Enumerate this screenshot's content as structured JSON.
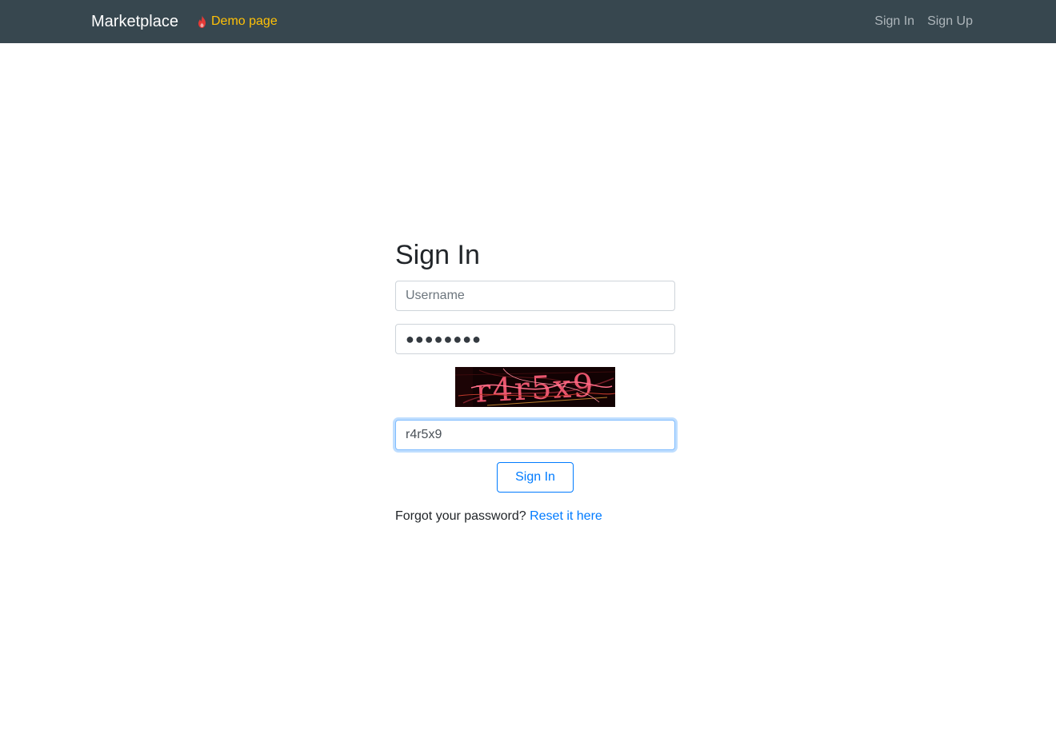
{
  "navbar": {
    "brand": "Marketplace",
    "demo_label": "Demo page",
    "demo_icon": "flame-icon",
    "links": [
      "Sign In",
      "Sign Up"
    ],
    "colors": {
      "background": "#37474f",
      "demo": "#ffc107",
      "flame": "#e53935"
    }
  },
  "signin": {
    "title": "Sign In",
    "username_placeholder": "Username",
    "username_value": "",
    "password_value": "●●●●●●●●",
    "captcha_text": "r4r5x9",
    "captcha_input_value": "r4r5x9",
    "submit_label": "Sign In",
    "forgot_text": "Forgot your password?",
    "reset_link": "Reset it here"
  }
}
